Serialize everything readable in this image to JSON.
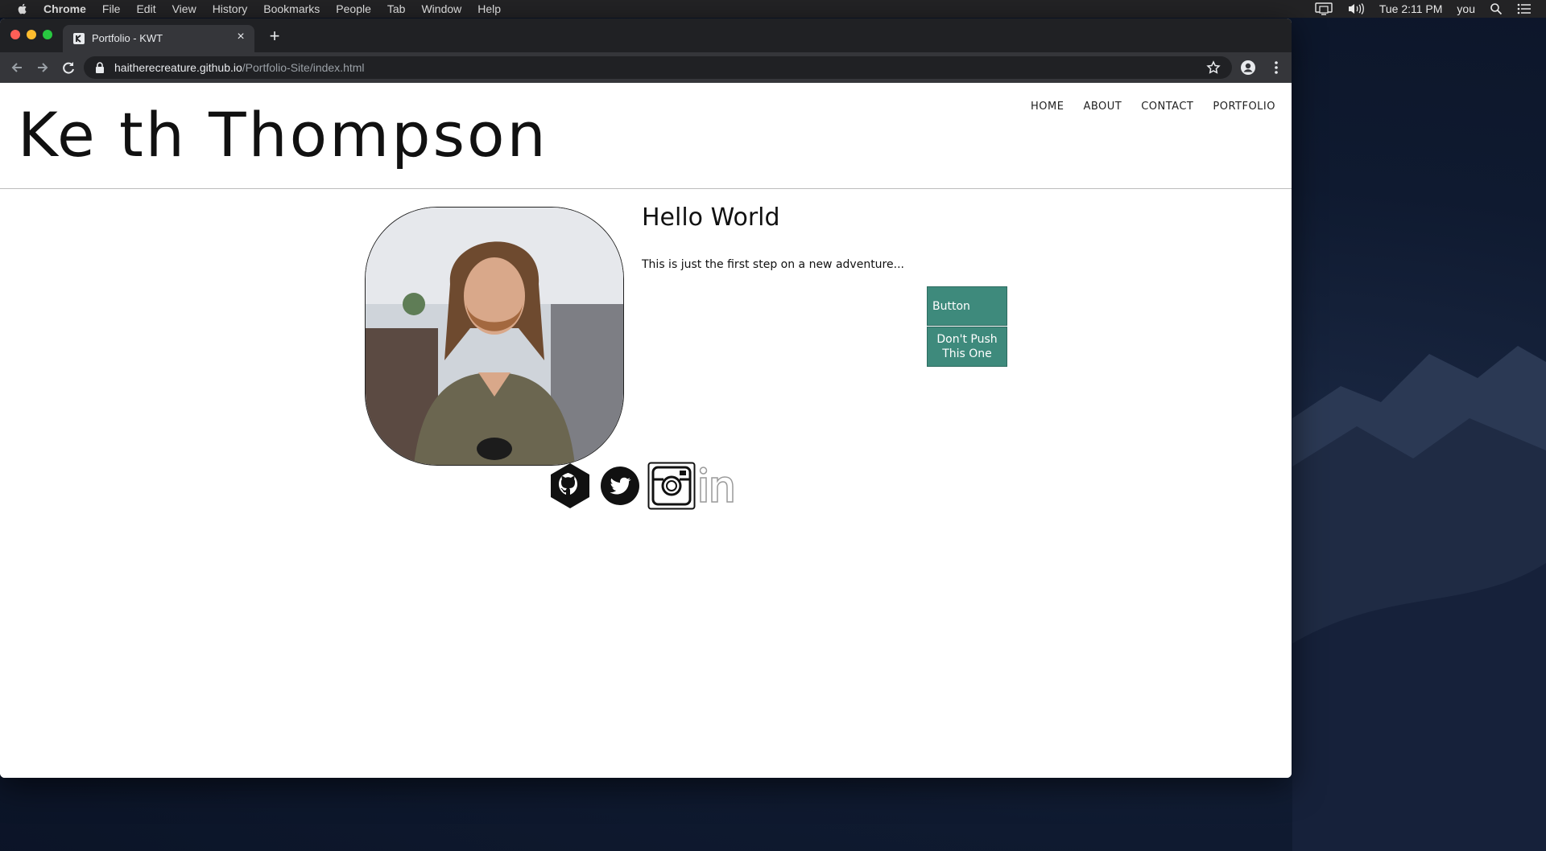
{
  "menubar": {
    "app_name": "Chrome",
    "items": [
      "File",
      "Edit",
      "View",
      "History",
      "Bookmarks",
      "People",
      "Tab",
      "Window",
      "Help"
    ],
    "clock": "Tue 2:11 PM",
    "user": "you"
  },
  "browser": {
    "tab_title": "Portfolio - KWT",
    "url_host": "haitherecreature.github.io",
    "url_path": "/Portfolio-Site/index.html"
  },
  "site": {
    "title": "Ke th Thompson",
    "nav": [
      "HOME",
      "ABOUT",
      "CONTACT",
      "PORTFOLIO"
    ],
    "heading": "Hello World",
    "intro": "This is just the first step on a new adventure...",
    "button_primary": "Button",
    "button_secondary_line1": "Don't Push",
    "button_secondary_line2": "This One"
  },
  "colors": {
    "button_bg": "#3e8a7c",
    "chrome_dark": "#202124",
    "chrome_toolbar": "#35363a"
  }
}
